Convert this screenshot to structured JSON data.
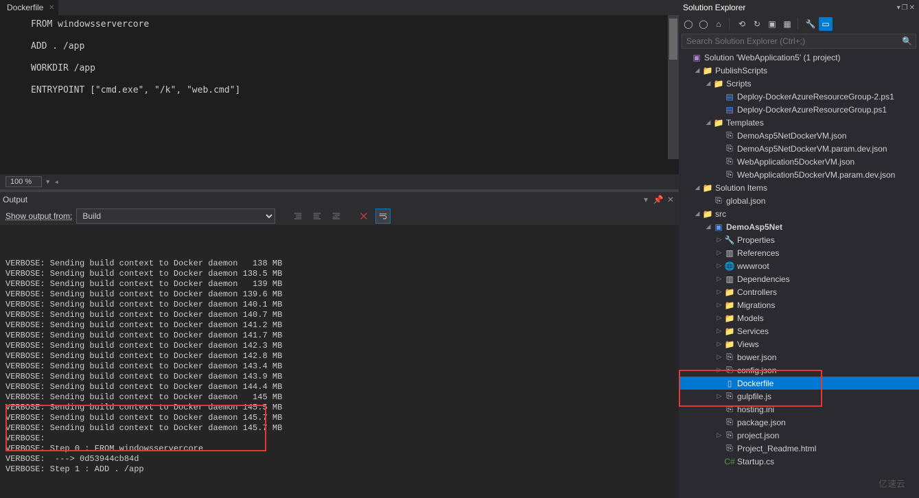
{
  "editor": {
    "tab_title": "Dockerfile",
    "lines": [
      "FROM windowsservercore",
      "",
      "ADD . /app",
      "",
      "WORKDIR /app",
      "",
      "ENTRYPOINT [\"cmd.exe\", \"/k\", \"web.cmd\"]"
    ],
    "zoom": "100 %"
  },
  "output": {
    "title": "Output",
    "show_from_label": "Show output from:",
    "source": "Build",
    "lines": [
      "VERBOSE: Sending build context to Docker daemon   138 MB",
      "VERBOSE: Sending build context to Docker daemon 138.5 MB",
      "VERBOSE: Sending build context to Docker daemon   139 MB",
      "VERBOSE: Sending build context to Docker daemon 139.6 MB",
      "VERBOSE: Sending build context to Docker daemon 140.1 MB",
      "VERBOSE: Sending build context to Docker daemon 140.7 MB",
      "VERBOSE: Sending build context to Docker daemon 141.2 MB",
      "VERBOSE: Sending build context to Docker daemon 141.7 MB",
      "VERBOSE: Sending build context to Docker daemon 142.3 MB",
      "VERBOSE: Sending build context to Docker daemon 142.8 MB",
      "VERBOSE: Sending build context to Docker daemon 143.4 MB",
      "VERBOSE: Sending build context to Docker daemon 143.9 MB",
      "VERBOSE: Sending build context to Docker daemon 144.4 MB",
      "VERBOSE: Sending build context to Docker daemon   145 MB",
      "VERBOSE: Sending build context to Docker daemon 145.5 MB",
      "VERBOSE: Sending build context to Docker daemon 145.7 MB",
      "VERBOSE: Sending build context to Docker daemon 145.7 MB",
      "VERBOSE:",
      "VERBOSE: Step 0 : FROM windowsservercore",
      "VERBOSE:  ---> 0d53944cb84d",
      "VERBOSE: Step 1 : ADD . /app"
    ]
  },
  "solution_explorer": {
    "title": "Solution Explorer",
    "search_placeholder": "Search Solution Explorer (Ctrl+;)",
    "root": "Solution 'WebApplication5' (1 project)",
    "tree": [
      {
        "indent": 1,
        "chev": "▢",
        "icon": "folder",
        "label": "PublishScripts"
      },
      {
        "indent": 2,
        "chev": "▢",
        "icon": "folder",
        "label": "Scripts"
      },
      {
        "indent": 3,
        "chev": "",
        "icon": "ps1",
        "label": "Deploy-DockerAzureResourceGroup-2.ps1"
      },
      {
        "indent": 3,
        "chev": "",
        "icon": "ps1",
        "label": "Deploy-DockerAzureResourceGroup.ps1"
      },
      {
        "indent": 2,
        "chev": "▢",
        "icon": "folder",
        "label": "Templates"
      },
      {
        "indent": 3,
        "chev": "",
        "icon": "json",
        "label": "DemoAsp5NetDockerVM.json"
      },
      {
        "indent": 3,
        "chev": "",
        "icon": "json",
        "label": "DemoAsp5NetDockerVM.param.dev.json"
      },
      {
        "indent": 3,
        "chev": "",
        "icon": "json",
        "label": "WebApplication5DockerVM.json"
      },
      {
        "indent": 3,
        "chev": "",
        "icon": "json",
        "label": "WebApplication5DockerVM.param.dev.json"
      },
      {
        "indent": 1,
        "chev": "▢",
        "icon": "folder",
        "label": "Solution Items"
      },
      {
        "indent": 2,
        "chev": "",
        "icon": "json",
        "label": "global.json"
      },
      {
        "indent": 1,
        "chev": "▢",
        "icon": "folder",
        "label": "src"
      },
      {
        "indent": 2,
        "chev": "▢",
        "icon": "proj",
        "label": "DemoAsp5Net",
        "bold": true
      },
      {
        "indent": 3,
        "chev": "▷",
        "icon": "wrench",
        "label": "Properties"
      },
      {
        "indent": 3,
        "chev": "▷",
        "icon": "refs",
        "label": "References"
      },
      {
        "indent": 3,
        "chev": "▷",
        "icon": "globe",
        "label": "wwwroot"
      },
      {
        "indent": 3,
        "chev": "▷",
        "icon": "refs",
        "label": "Dependencies"
      },
      {
        "indent": 3,
        "chev": "▷",
        "icon": "folder",
        "label": "Controllers"
      },
      {
        "indent": 3,
        "chev": "▷",
        "icon": "folder",
        "label": "Migrations"
      },
      {
        "indent": 3,
        "chev": "▷",
        "icon": "folder",
        "label": "Models"
      },
      {
        "indent": 3,
        "chev": "▷",
        "icon": "folder",
        "label": "Services"
      },
      {
        "indent": 3,
        "chev": "▷",
        "icon": "folder",
        "label": "Views"
      },
      {
        "indent": 3,
        "chev": "▷",
        "icon": "json",
        "label": "bower.json"
      },
      {
        "indent": 3,
        "chev": "▷",
        "icon": "json",
        "label": "config.json"
      },
      {
        "indent": 3,
        "chev": "",
        "icon": "file",
        "label": "Dockerfile",
        "selected": true
      },
      {
        "indent": 3,
        "chev": "▷",
        "icon": "json",
        "label": "gulpfile.js"
      },
      {
        "indent": 3,
        "chev": "",
        "icon": "json",
        "label": "hosting.ini"
      },
      {
        "indent": 3,
        "chev": "",
        "icon": "json",
        "label": "package.json"
      },
      {
        "indent": 3,
        "chev": "▷",
        "icon": "json",
        "label": "project.json"
      },
      {
        "indent": 3,
        "chev": "",
        "icon": "json",
        "label": "Project_Readme.html"
      },
      {
        "indent": 3,
        "chev": "",
        "icon": "cs",
        "label": "Startup.cs"
      }
    ]
  },
  "watermark": "亿速云"
}
